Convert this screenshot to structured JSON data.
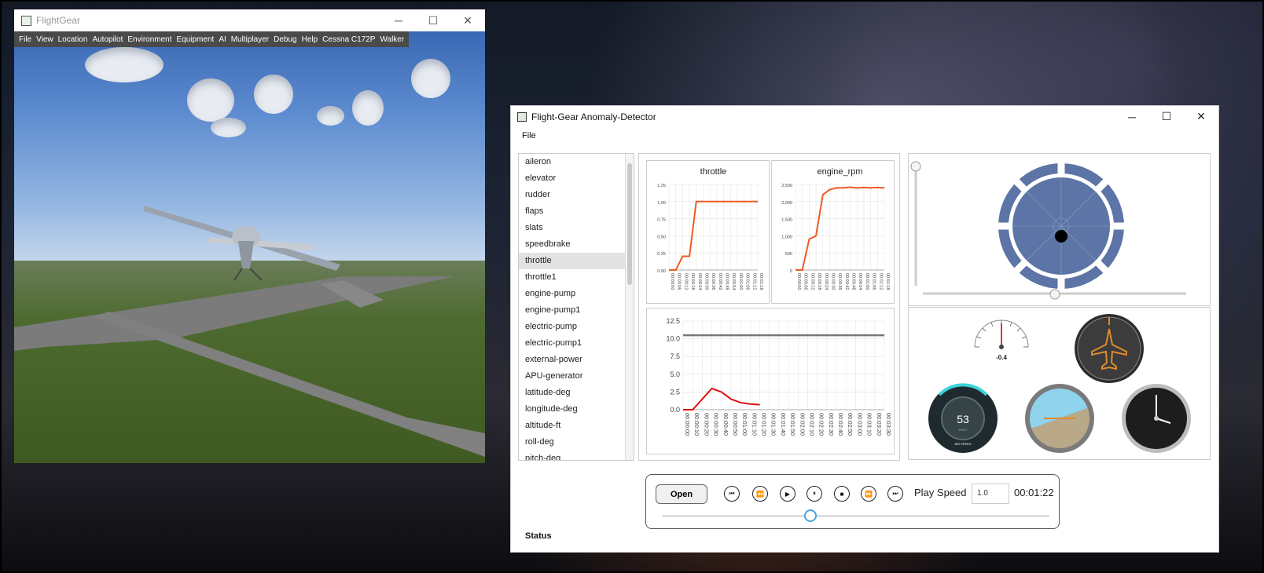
{
  "flightgear": {
    "title": "FlightGear",
    "menu": [
      "File",
      "View",
      "Location",
      "Autopilot",
      "Environment",
      "Equipment",
      "AI",
      "Multiplayer",
      "Debug",
      "Help",
      "Cessna C172P",
      "Walker"
    ]
  },
  "detector": {
    "title": "Flight-Gear Anomaly-Detector",
    "menu_file": "File",
    "attributes": [
      "aileron",
      "elevator",
      "rudder",
      "flaps",
      "slats",
      "speedbrake",
      "throttle",
      "throttle1",
      "engine-pump",
      "engine-pump1",
      "electric-pump",
      "electric-pump1",
      "external-power",
      "APU-generator",
      "latitude-deg",
      "longitude-deg",
      "altitude-ft",
      "roll-deg",
      "pitch-deg"
    ],
    "selected_attribute": "throttle",
    "player": {
      "open_label": "Open",
      "play_speed_label": "Play Speed",
      "play_speed_value": "1.0",
      "time": "00:01:22",
      "position_fraction": 0.38
    },
    "status_label": "Status",
    "altimeter_readout": "-0.4",
    "airspeed_value": "53",
    "airspeed_label": "AIR SPEED",
    "airspeed_unit": "KNOT"
  },
  "colors": {
    "line_orange": "#f05a22",
    "line_red": "#e01010",
    "joystick_blue": "#5d74a6"
  },
  "chart_data": [
    {
      "type": "line",
      "title": "throttle",
      "x": [
        "00:00:00",
        "00:00:06",
        "00:00:12",
        "00:00:18",
        "00:00:24",
        "00:00:30",
        "00:00:36",
        "00:00:42",
        "00:00:48",
        "00:00:54",
        "00:01:00",
        "00:01:06",
        "00:01:12",
        "00:01:18"
      ],
      "values": [
        0,
        0,
        0.2,
        0.2,
        1.0,
        1.0,
        1.0,
        1.0,
        1.0,
        1.0,
        1.0,
        1.0,
        1.0,
        1.0
      ],
      "yticks": [
        "0.00",
        "0.25",
        "0.50",
        "0.75",
        "1.00",
        "1.25"
      ],
      "ylim": [
        0,
        1.25
      ]
    },
    {
      "type": "line",
      "title": "engine_rpm",
      "x": [
        "00:00:00",
        "00:00:06",
        "00:00:12",
        "00:00:18",
        "00:00:24",
        "00:00:30",
        "00:00:36",
        "00:00:42",
        "00:00:48",
        "00:00:54",
        "00:01:00",
        "00:01:06",
        "00:01:12",
        "00:01:18"
      ],
      "values": [
        0,
        0,
        900,
        1000,
        2200,
        2350,
        2400,
        2400,
        2420,
        2400,
        2410,
        2400,
        2410,
        2400
      ],
      "yticks": [
        "0",
        "500",
        "1,000",
        "1,500",
        "2,000",
        "2,500"
      ],
      "ylim": [
        0,
        2500
      ]
    },
    {
      "type": "line",
      "title": "",
      "x": [
        "00:00:00",
        "00:00:10",
        "00:00:20",
        "00:00:30",
        "00:00:40",
        "00:00:50",
        "00:01:00",
        "00:01:10",
        "00:01:20",
        "00:01:30",
        "00:01:40",
        "00:01:50",
        "00:02:00",
        "00:02:10",
        "00:02:20",
        "00:02:30",
        "00:02:40",
        "00:02:50",
        "00:03:00",
        "00:03:10",
        "00:03:20",
        "00:03:30"
      ],
      "yticks": [
        "0.0",
        "2.5",
        "5.0",
        "7.5",
        "10.0",
        "12.5"
      ],
      "ylim": [
        0,
        12.5
      ],
      "series": [
        {
          "values": [
            10.5,
            10.5,
            10.5,
            10.5,
            10.5,
            10.5,
            10.5,
            10.5,
            10.5,
            10.5,
            10.5,
            10.5,
            10.5,
            10.5,
            10.5,
            10.5,
            10.5,
            10.5,
            10.5,
            10.5,
            10.5,
            10.5
          ]
        },
        {
          "values": [
            0,
            0,
            1.5,
            3.0,
            2.5,
            1.5,
            1.0,
            0.8,
            0.7
          ]
        }
      ]
    }
  ]
}
